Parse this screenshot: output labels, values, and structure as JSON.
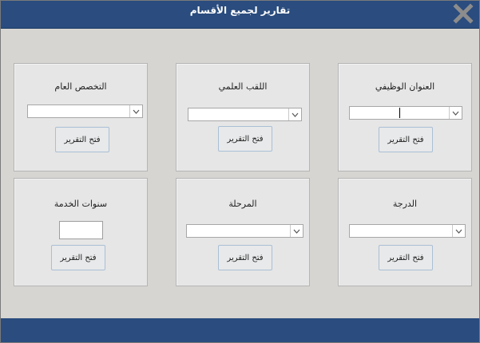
{
  "window": {
    "title": "تقارير لجميع الأقسام",
    "close_icon": "close-x-icon"
  },
  "panels": [
    {
      "id": "job-title",
      "label": "العنوان الوظيفي",
      "control": "select",
      "value": "",
      "button": "فتح التقرير"
    },
    {
      "id": "academic-title",
      "label": "اللقب العلمي",
      "control": "select",
      "value": "",
      "button": "فتح التقرير"
    },
    {
      "id": "general-specialization",
      "label": "التخصص العام",
      "control": "select",
      "value": "",
      "button": "فتح التقرير"
    },
    {
      "id": "grade",
      "label": "الدرجة",
      "control": "select",
      "value": "",
      "button": "فتح التقرير"
    },
    {
      "id": "stage",
      "label": "المرحلة",
      "control": "select",
      "value": "",
      "button": "فتح التقرير"
    },
    {
      "id": "years-of-service",
      "label": "سنوات الخدمة",
      "control": "textbox",
      "value": "",
      "button": "فتح التقرير"
    }
  ],
  "colors": {
    "titlebar": "#2a4c7e",
    "background": "#d6d5d1",
    "panel": "#e6e6e6"
  }
}
